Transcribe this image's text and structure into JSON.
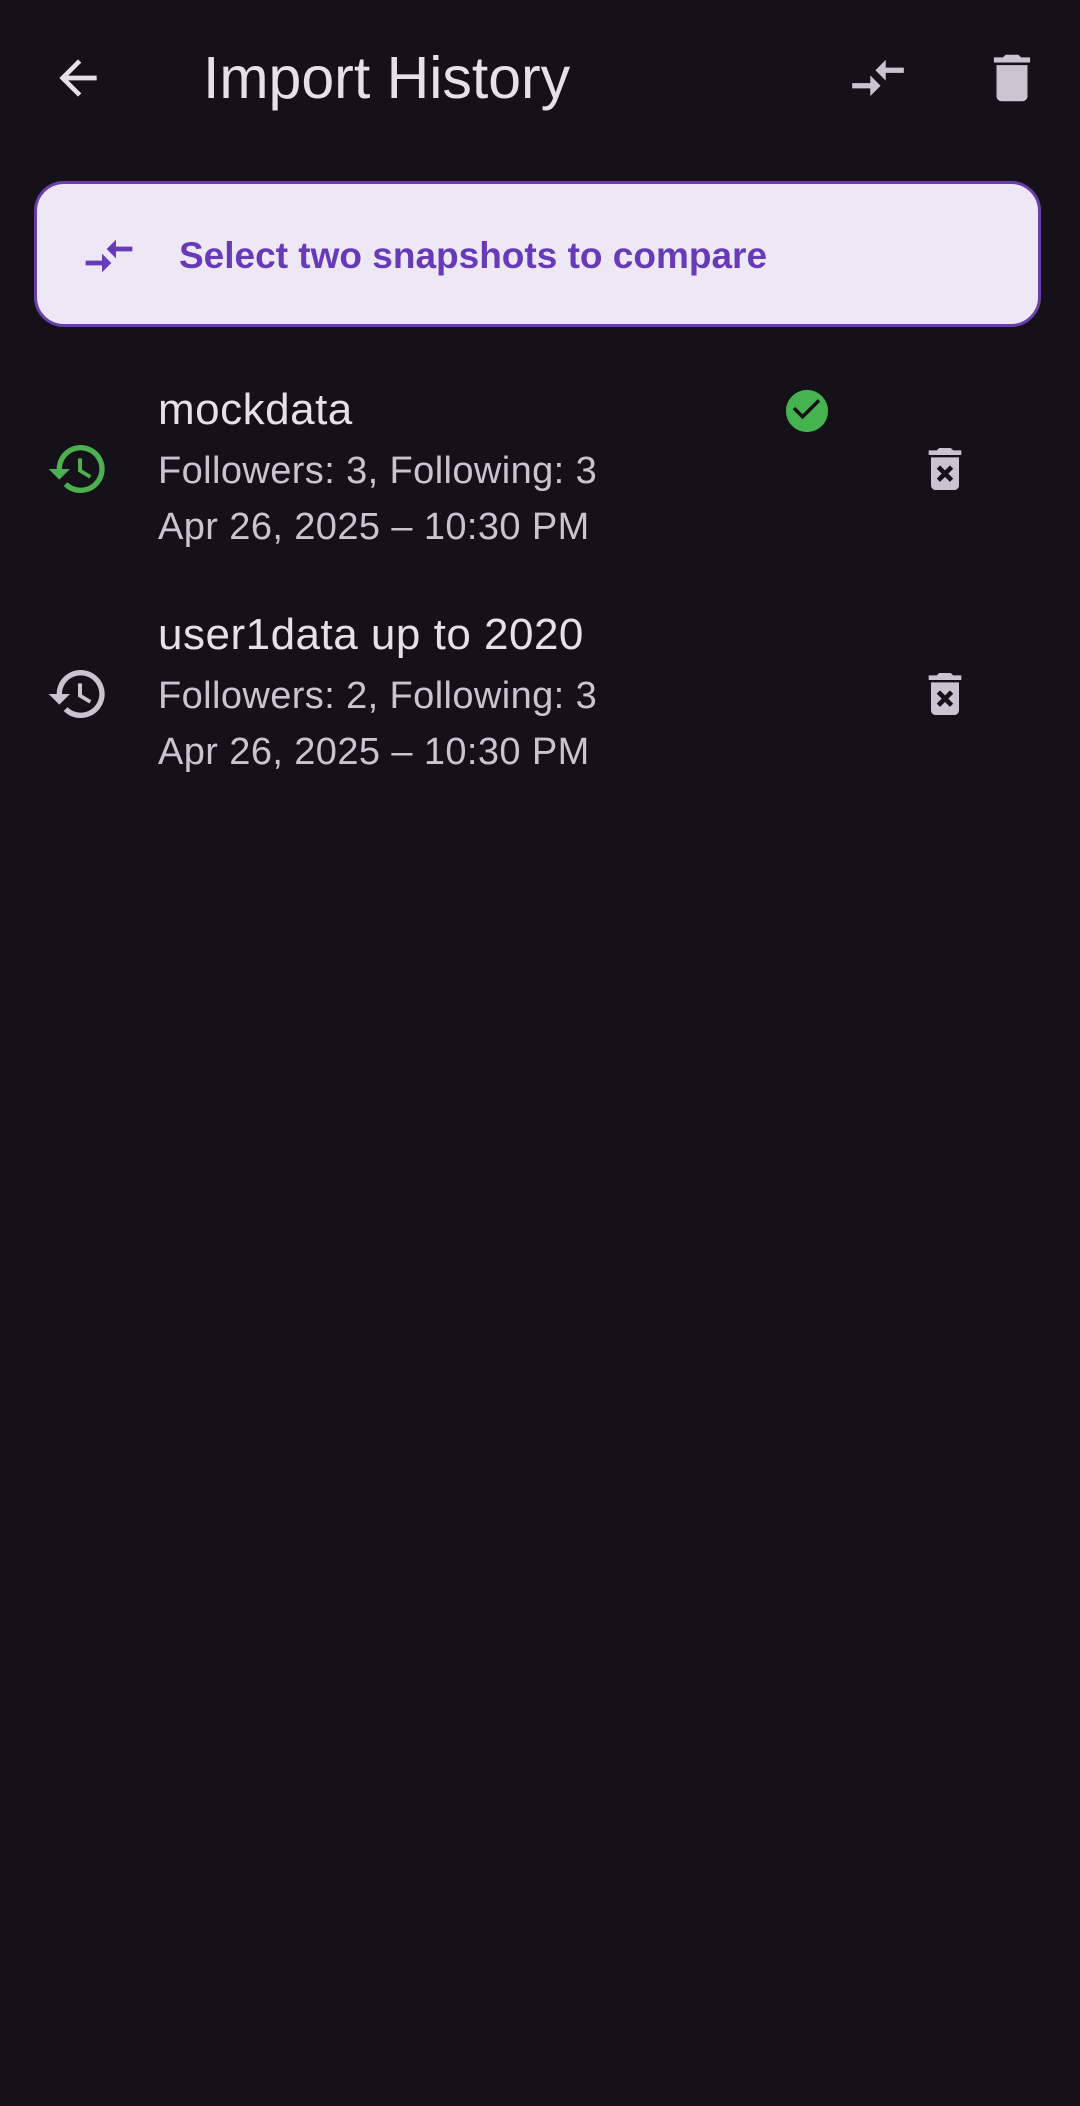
{
  "app_bar": {
    "title": "Import History",
    "icons": {
      "back": "arrow-back-icon",
      "compare": "compare-arrows-icon",
      "delete_all": "delete-icon"
    }
  },
  "banner": {
    "text": "Select two snapshots to compare",
    "icon": "compare-arrows-icon"
  },
  "snapshots": [
    {
      "name": "mockdata",
      "counts": "Followers: 3, Following: 3",
      "date": "Apr 26, 2025 – 10:30 PM",
      "selected": true,
      "icon": "history-icon",
      "delete_icon": "delete-forever-icon"
    },
    {
      "name": "user1data up to 2020",
      "counts": "Followers: 2, Following: 3",
      "date": "Apr 26, 2025 – 10:30 PM",
      "selected": false,
      "icon": "history-icon",
      "delete_icon": "delete-forever-icon"
    }
  ],
  "colors": {
    "background": "#141218",
    "on_surface": "#e6e0e9",
    "on_surface_variant": "#cac4d0",
    "primary": "#673ab7",
    "banner_bg": "#ede7f6",
    "banner_border": "#6a3fa9",
    "selected_green": "#4caf50",
    "check_green": "#45b34f"
  }
}
